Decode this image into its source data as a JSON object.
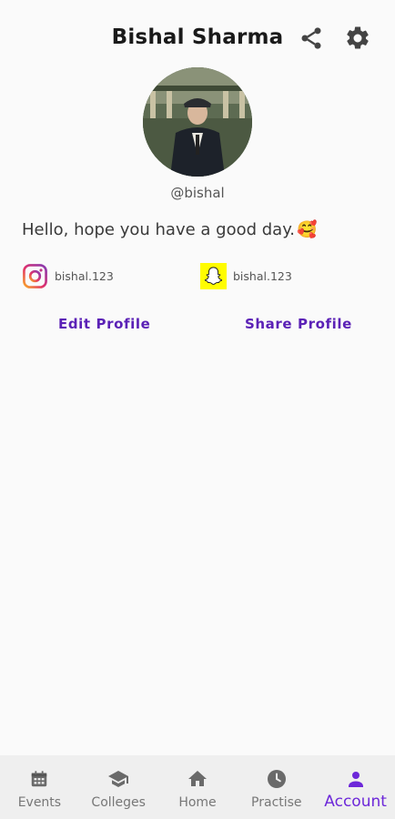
{
  "header": {
    "title": "Bishal Sharma",
    "share_icon": "share-icon",
    "settings_icon": "gear-icon"
  },
  "profile": {
    "handle": "@bishal",
    "bio": "Hello, hope you have a good day.",
    "bio_emoji": "🥰",
    "instagram": {
      "icon": "instagram-icon",
      "username": "bishal.123"
    },
    "snapchat": {
      "icon": "snapchat-icon",
      "username": "bishal.123"
    }
  },
  "actions": {
    "edit_label": "Edit Profile",
    "share_label": "Share Profile"
  },
  "nav": {
    "items": [
      {
        "label": "Events",
        "icon": "calendar-icon"
      },
      {
        "label": "Colleges",
        "icon": "graduation-cap-icon"
      },
      {
        "label": "Home",
        "icon": "home-icon"
      },
      {
        "label": "Practise",
        "icon": "clock-icon"
      },
      {
        "label": "Account",
        "icon": "person-icon"
      }
    ],
    "active_index": 4
  },
  "colors": {
    "accent": "#6d28d9",
    "link": "#5b21b6",
    "instagram": "#c13584",
    "snapchat": "#fffc00"
  }
}
